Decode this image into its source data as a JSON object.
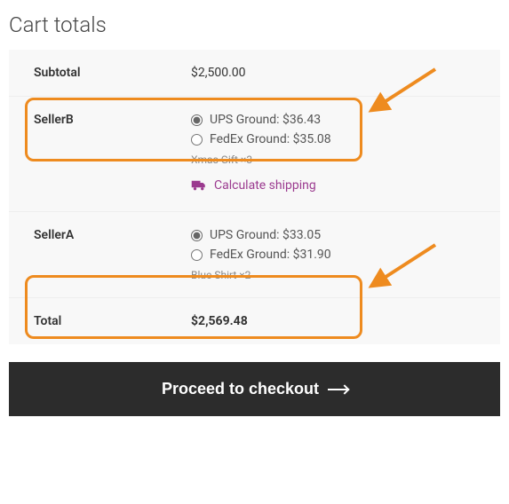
{
  "title": "Cart totals",
  "subtotal": {
    "label": "Subtotal",
    "value": "$2,500.00"
  },
  "sellers": [
    {
      "name": "SellerB",
      "options": [
        {
          "label": "UPS Ground: $36.43",
          "selected": true
        },
        {
          "label": "FedEx Ground: $35.08",
          "selected": false
        }
      ],
      "items_note": "Xmas Gift ×3",
      "show_calc": true
    },
    {
      "name": "SellerA",
      "options": [
        {
          "label": "UPS Ground: $33.05",
          "selected": true
        },
        {
          "label": "FedEx Ground: $31.90",
          "selected": false
        }
      ],
      "items_note": "Blue Shirt ×2",
      "show_calc": false
    }
  ],
  "calc_label": "Calculate shipping",
  "total": {
    "label": "Total",
    "value": "$2,569.48"
  },
  "checkout_label": "Proceed to checkout",
  "colors": {
    "accent": "#9b3a8f",
    "highlight": "#ee8b1f",
    "button": "#2c2c2c"
  }
}
